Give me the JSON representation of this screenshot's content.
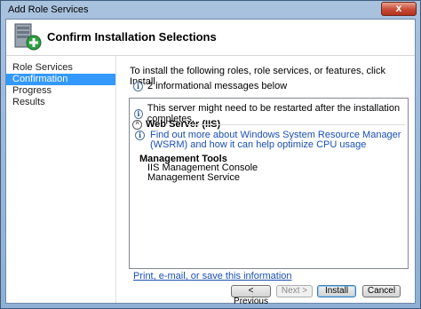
{
  "window": {
    "title": "Add Role Services",
    "close_glyph": "x"
  },
  "header": {
    "title": "Confirm Installation Selections",
    "icon": "server-add-icon"
  },
  "nav": {
    "items": [
      {
        "label": "Role Services",
        "selected": false
      },
      {
        "label": "Confirmation",
        "selected": true
      },
      {
        "label": "Progress",
        "selected": false
      },
      {
        "label": "Results",
        "selected": false
      }
    ]
  },
  "content": {
    "intro": "To install the following roles, role services, or features, click Install.",
    "messages_summary": "2 informational messages below",
    "restart_message": "This server might need to be restarted after the installation completes.",
    "section_title": "Web Server (IIS)",
    "wsrm_link": "Find out more about Windows System Resource Manager (WSRM) and how it can help optimize CPU usage",
    "management_tools_title": "Management Tools",
    "management_items": [
      "IIS Management Console",
      "Management Service"
    ],
    "print_link": "Print, e-mail, or save this information"
  },
  "buttons": {
    "previous": "< Previous",
    "next": "Next >",
    "install": "Install",
    "cancel": "Cancel"
  }
}
